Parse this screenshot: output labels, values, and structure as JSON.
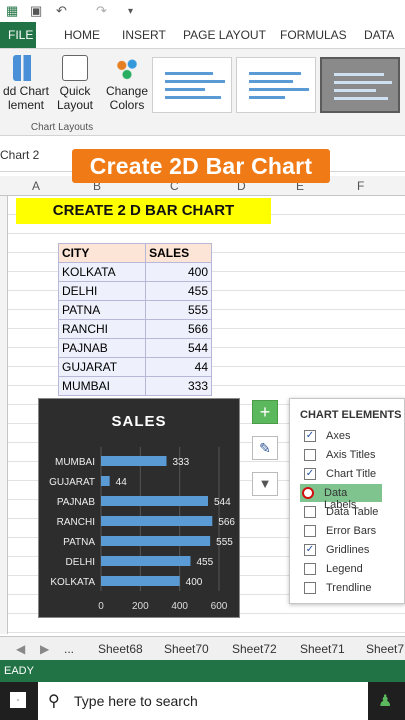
{
  "ribbon_tabs": {
    "file": "FILE",
    "home": "HOME",
    "insert": "INSERT",
    "page_layout": "PAGE LAYOUT",
    "formulas": "FORMULAS",
    "data": "DATA"
  },
  "ribbon": {
    "add_chart_element": "dd Chart\nlement",
    "quick_layout": "Quick\nLayout",
    "change_colors": "Change\nColors",
    "group_label": "Chart Layouts"
  },
  "namebox": "Chart 2",
  "banner": "Create 2D Bar Chart",
  "columns": [
    "A",
    "B",
    "C",
    "D",
    "E",
    "F"
  ],
  "heading": "CREATE 2 D BAR CHART",
  "table": {
    "headers": [
      "CITY",
      "SALES"
    ],
    "rows": [
      [
        "KOLKATA",
        "400"
      ],
      [
        "DELHI",
        "455"
      ],
      [
        "PATNA",
        "555"
      ],
      [
        "RANCHI",
        "566"
      ],
      [
        "PAJNAB",
        "544"
      ],
      [
        "GUJARAT",
        "44"
      ],
      [
        "MUMBAI",
        "333"
      ]
    ]
  },
  "chart_data": {
    "type": "bar",
    "title": "SALES",
    "categories": [
      "KOLKATA",
      "DELHI",
      "PATNA",
      "RANCHI",
      "PAJNAB",
      "GUJARAT",
      "MUMBAI"
    ],
    "values": [
      400,
      455,
      555,
      566,
      544,
      44,
      333
    ],
    "ticks": [
      "0",
      "200",
      "400",
      "600"
    ],
    "xlim": [
      0,
      600
    ],
    "grid": true,
    "bar_color": "#5b9bd5"
  },
  "chart_elements": {
    "title": "CHART ELEMENTS",
    "items": [
      {
        "label": "Axes",
        "checked": "✓"
      },
      {
        "label": "Axis Titles",
        "checked": ""
      },
      {
        "label": "Chart Title",
        "checked": "✓"
      },
      {
        "label": "Data Labels",
        "checked": ""
      },
      {
        "label": "Data Table",
        "checked": ""
      },
      {
        "label": "Error Bars",
        "checked": ""
      },
      {
        "label": "Gridlines",
        "checked": "✓"
      },
      {
        "label": "Legend",
        "checked": ""
      },
      {
        "label": "Trendline",
        "checked": ""
      }
    ]
  },
  "sheet_tabs": [
    "...",
    "Sheet68",
    "Sheet70",
    "Sheet72",
    "Sheet71",
    "Sheet7"
  ],
  "status": "EADY",
  "taskbar": {
    "search_placeholder": "Type here to search"
  },
  "colors": {
    "excel_green": "#217346",
    "banner_orange": "#f07b16",
    "heading_yellow": "#ffff00",
    "chart_bg": "#2d2d2d"
  }
}
